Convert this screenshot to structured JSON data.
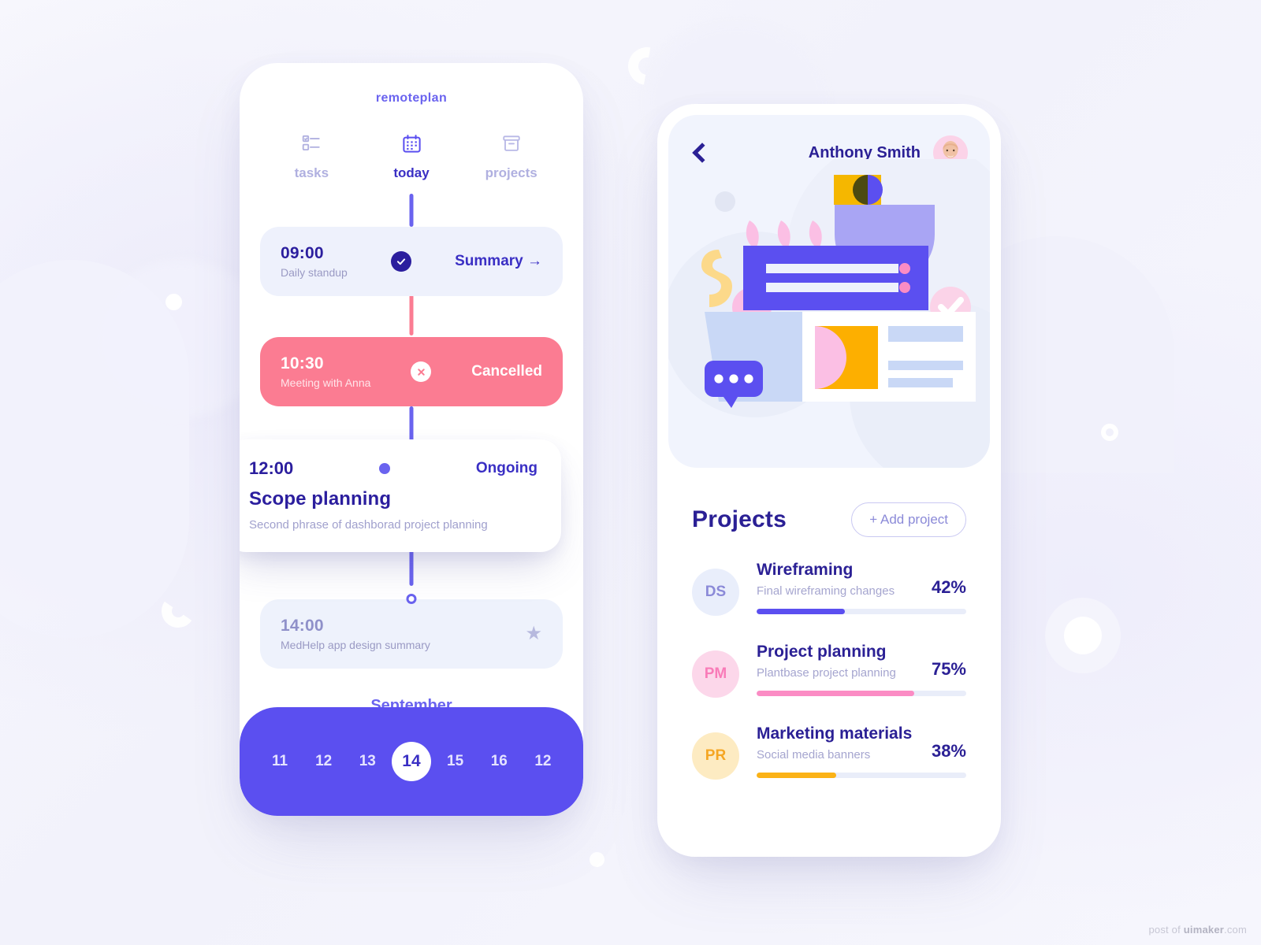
{
  "colors": {
    "primary": "#5b4ff0",
    "primary_dark": "#2b1e9e",
    "accent_pink": "#fb7c92",
    "accent_yellow": "#fbb216",
    "muted": "#a0a0cd",
    "pale_card": "#eef1fc"
  },
  "left_phone": {
    "brand": "remoteplan",
    "tabs": [
      {
        "label": "tasks",
        "icon": "checklist-icon",
        "active": false
      },
      {
        "label": "today",
        "icon": "calendar-icon",
        "active": true
      },
      {
        "label": "projects",
        "icon": "archive-box-icon",
        "active": false
      }
    ],
    "events": [
      {
        "time": "09:00",
        "subtitle": "Daily standup",
        "status": "Summary →",
        "state": "done",
        "marker": "check-badge-icon"
      },
      {
        "time": "10:30",
        "subtitle": "Meeting with Anna",
        "status": "Cancelled",
        "state": "cancelled",
        "marker": "x-badge-icon"
      },
      {
        "time": "12:00",
        "title": "Scope planning",
        "description": "Second phrase of dashborad project planning",
        "status": "Ongoing",
        "state": "ongoing",
        "marker": "filled-dot-icon"
      },
      {
        "time": "14:00",
        "subtitle": "MedHelp app design summary",
        "state": "upcoming",
        "marker": "hollow-dot-icon",
        "favorite_icon": "star-icon"
      }
    ],
    "calendar": {
      "month": "September",
      "days": [
        "11",
        "12",
        "13",
        "14",
        "15",
        "16",
        "12"
      ],
      "selected": "14"
    }
  },
  "right_phone": {
    "back_icon": "back-chevron-icon",
    "user_name": "Anthony Smith",
    "avatar_icon": "user-avatar",
    "illustration_icon": "workspace-illustration",
    "projects_heading": "Projects",
    "add_project_label": "+  Add project",
    "projects": [
      {
        "initials": "DS",
        "name": "Wireframing",
        "subtitle": "Final wireframing changes",
        "percent": "42%",
        "progress": 42,
        "bar_color": "#5b4ff0",
        "av_bg": "#e9eefb",
        "av_fg": "#8b8ad8"
      },
      {
        "initials": "PM",
        "name": "Project planning",
        "subtitle": "Plantbase project planning",
        "percent": "75%",
        "progress": 75,
        "bar_color": "#fb8cc4",
        "av_bg": "#fcd7ea",
        "av_fg": "#f97bb8"
      },
      {
        "initials": "PR",
        "name": "Marketing materials",
        "subtitle": "Social media banners",
        "percent": "38%",
        "progress": 38,
        "bar_color": "#fbb216",
        "av_bg": "#fdebc2",
        "av_fg": "#f5a623"
      }
    ]
  },
  "watermark": {
    "prefix": "post of ",
    "brand": "uimaker",
    "suffix": ".com"
  }
}
